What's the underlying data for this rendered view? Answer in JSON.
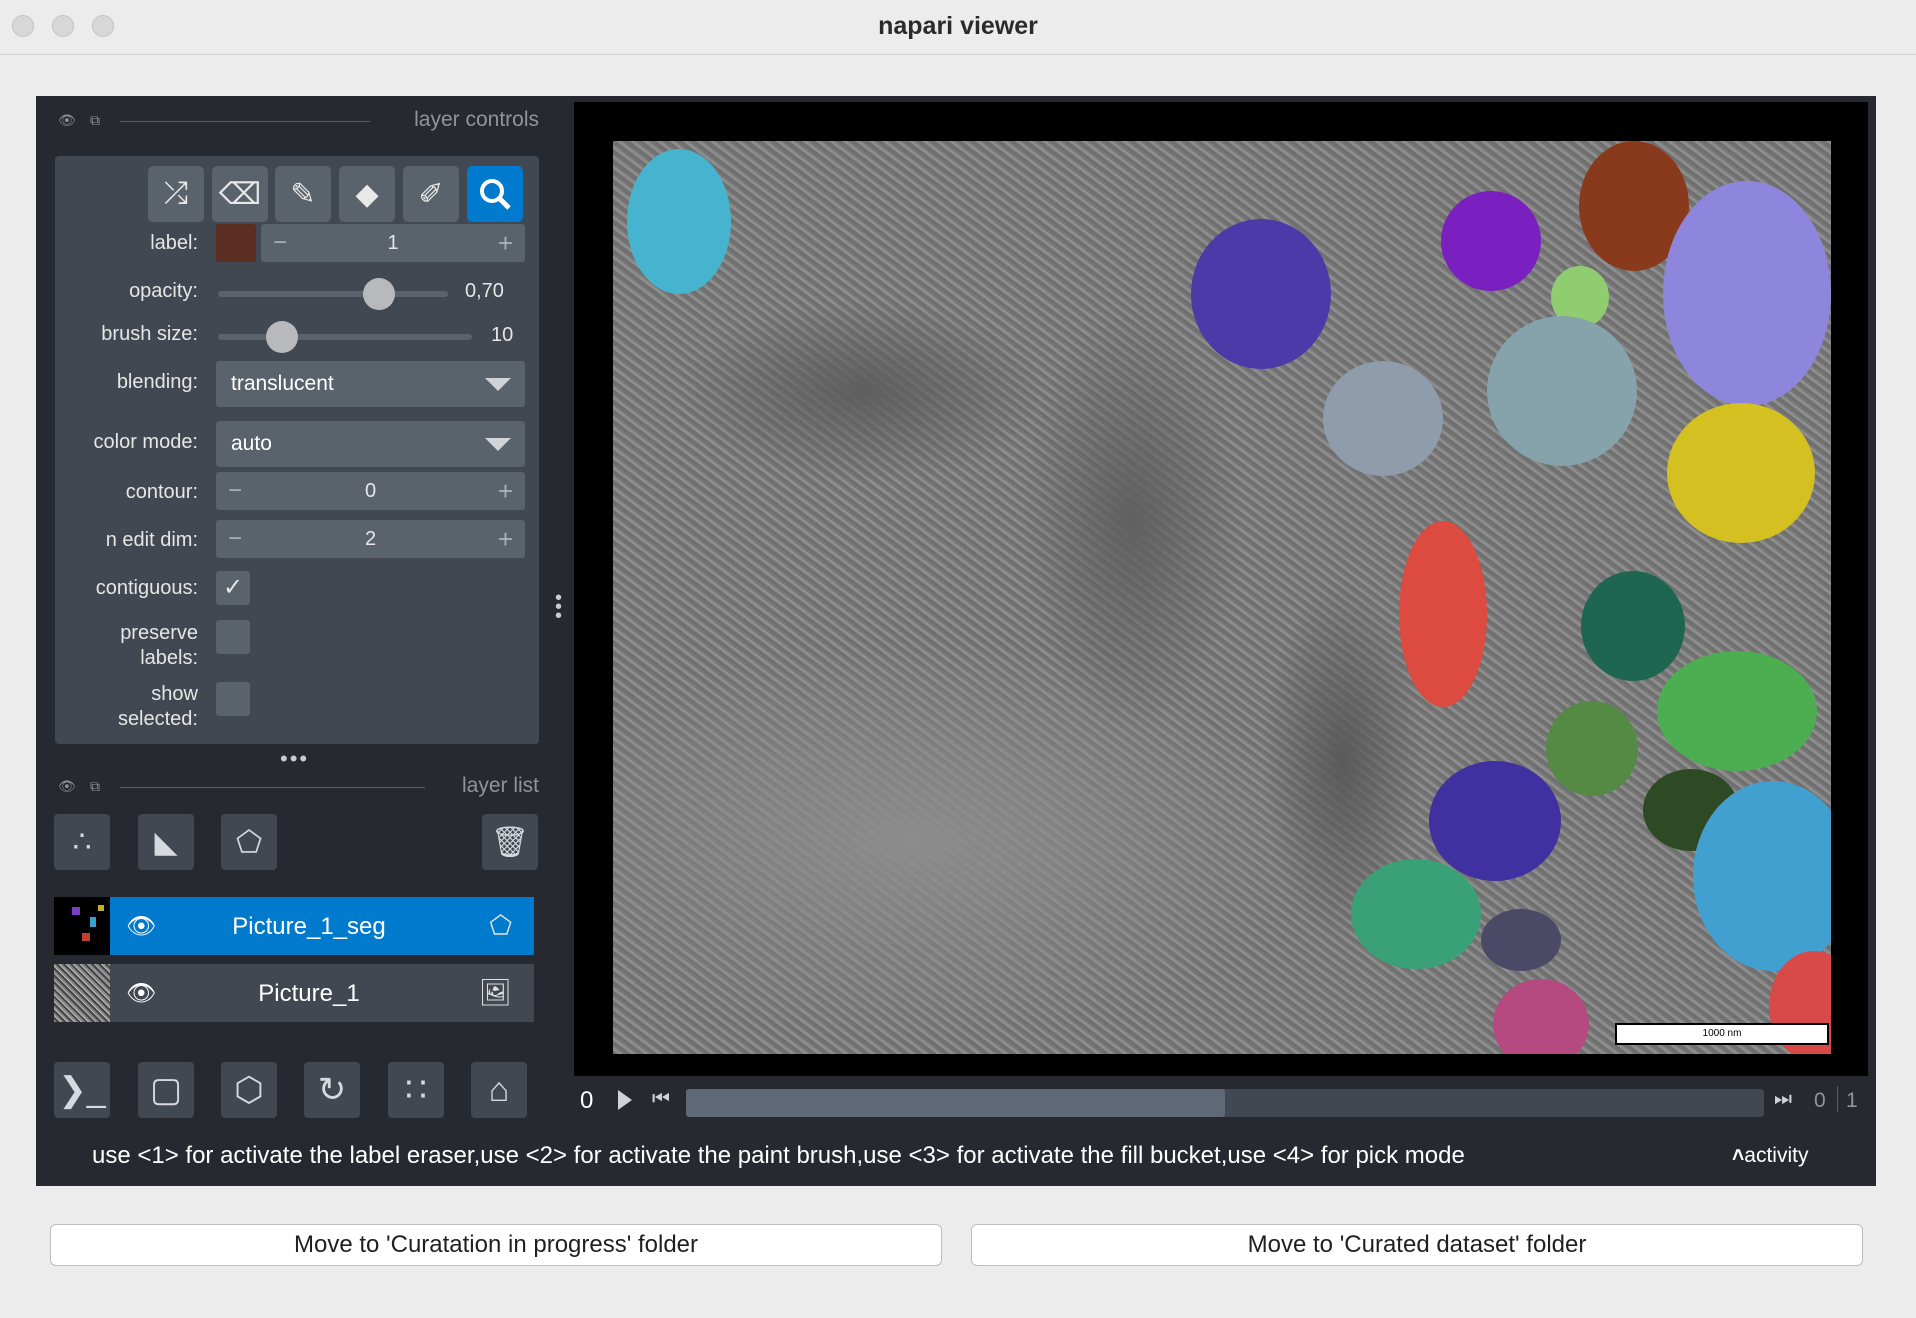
{
  "window": {
    "title": "napari viewer"
  },
  "layer_controls": {
    "title": "layer controls",
    "label": {
      "label": "label:",
      "value": "1",
      "swatch_color": "#5c2e22"
    },
    "opacity": {
      "label": "opacity:",
      "value": "0,70",
      "fraction": 0.7
    },
    "brush_size": {
      "label": "brush size:",
      "value": "10",
      "fraction": 0.25
    },
    "blending": {
      "label": "blending:",
      "value": "translucent"
    },
    "color_mode": {
      "label": "color mode:",
      "value": "auto"
    },
    "contour": {
      "label": "contour:",
      "value": "0"
    },
    "n_edit_dim": {
      "label": "n edit dim:",
      "value": "2"
    },
    "contiguous": {
      "label": "contiguous:",
      "checked": true
    },
    "preserve_labels": {
      "label_line1": "preserve",
      "label_line2": "labels:",
      "checked": false
    },
    "show_selected": {
      "label_line1": "show",
      "label_line2": "selected:",
      "checked": false
    },
    "tools": [
      "shuffle-icon",
      "eraser-icon",
      "paint-brush-icon",
      "fill-bucket-icon",
      "color-picker-icon",
      "pan-zoom-icon"
    ],
    "active_tool": "pan-zoom-icon"
  },
  "layer_list": {
    "title": "layer list",
    "layers": [
      {
        "name": "Picture_1_seg",
        "type": "labels",
        "selected": true
      },
      {
        "name": "Picture_1",
        "type": "image",
        "selected": false
      }
    ]
  },
  "dims": {
    "current": "0",
    "slider_fraction": 0.5,
    "right_value": "0",
    "max": "1"
  },
  "canvas": {
    "scale_bar_text": "1000 nm"
  },
  "status_bar": {
    "message": "use <1> for activate the label eraser,use <2> for activate the paint brush,use <3> for activate the fill bucket,use <4> for pick mode",
    "activity": "activity"
  },
  "buttons": {
    "curation_in_progress": "Move to 'Curatation in progress' folder",
    "curated_dataset": "Move to 'Curated dataset' folder"
  },
  "colors": {
    "accent": "#007acc",
    "panel": "#262930",
    "control": "#414851"
  }
}
